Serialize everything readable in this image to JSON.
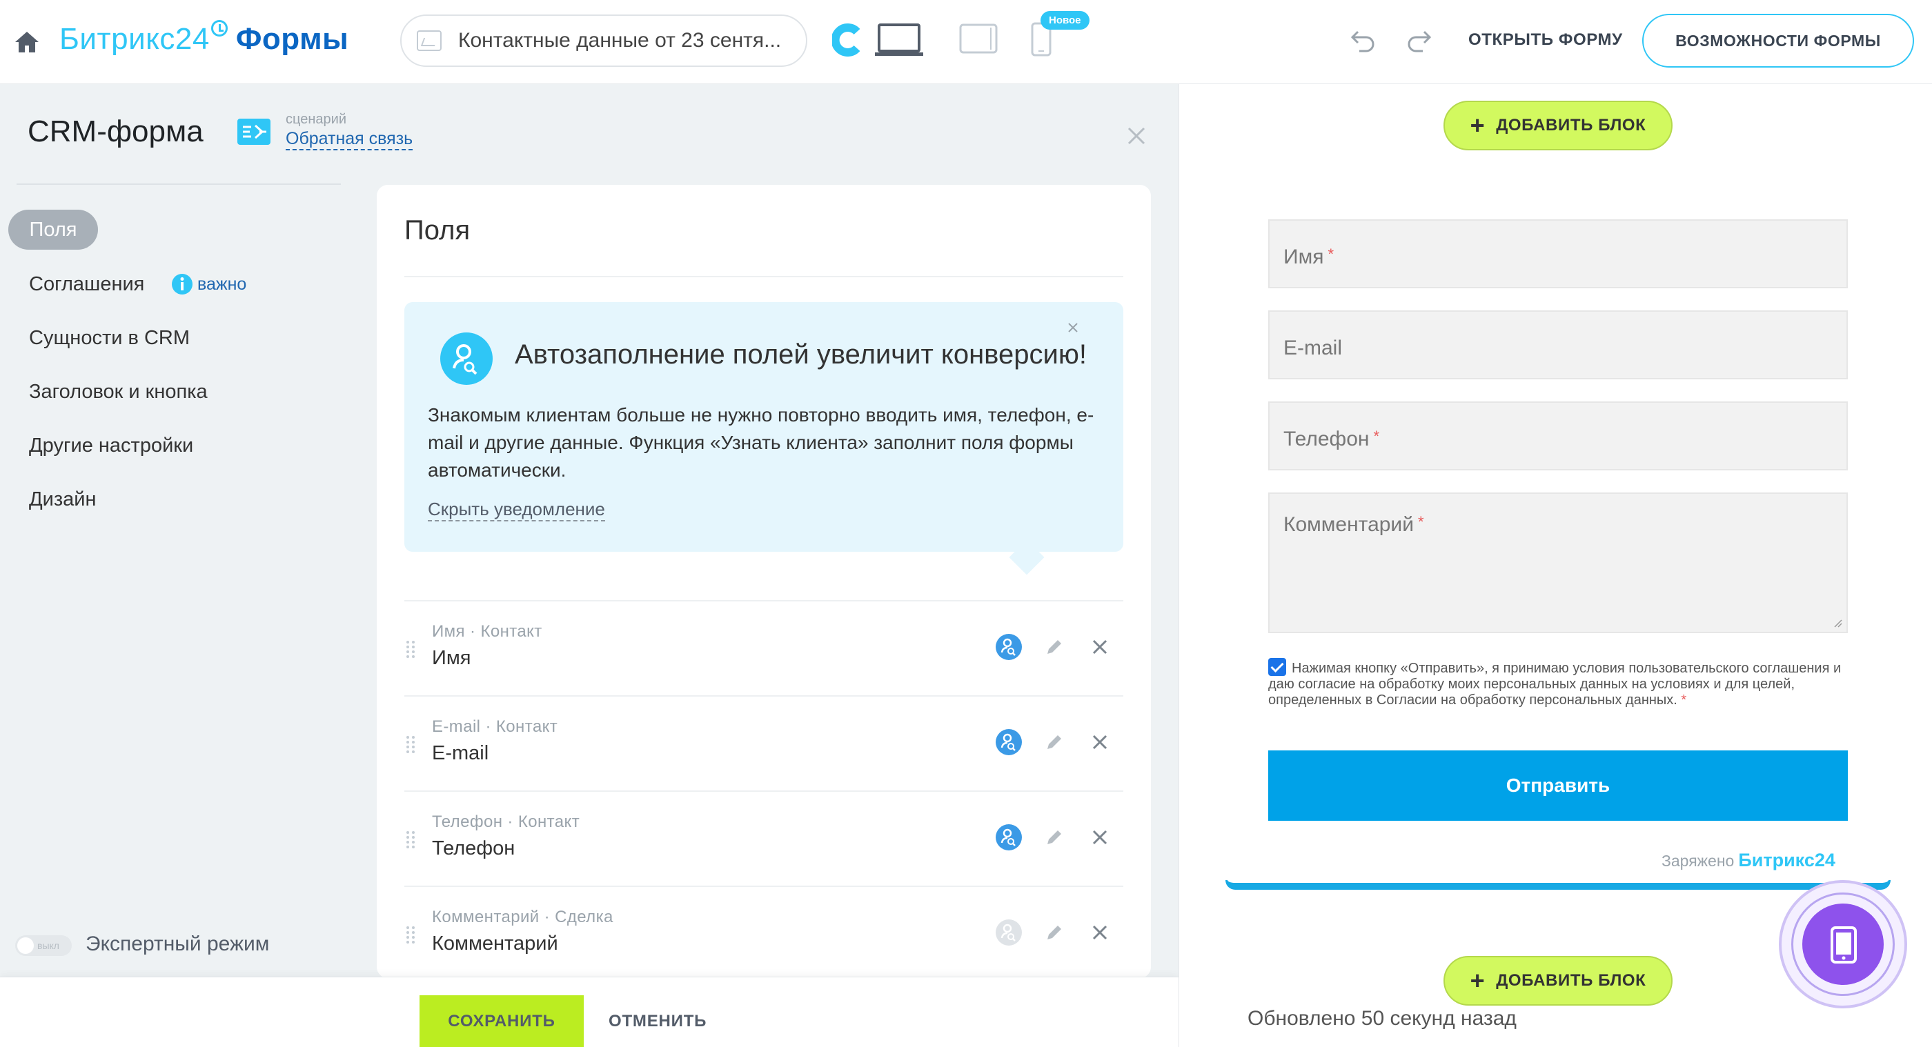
{
  "header": {
    "logo_b24": "Битрикс24",
    "logo_forms": "Формы",
    "form_title": "Контактные данные от 23 сентя...",
    "badge_new": "Новое",
    "open_form": "ОТКРЫТЬ ФОРМУ",
    "features": "ВОЗМОЖНОСТИ ФОРМЫ"
  },
  "sidebar": {
    "title": "CRM-форма",
    "scenario_label": "сценарий",
    "scenario_link": "Обратная связь",
    "items": [
      {
        "label": "Поля"
      },
      {
        "label": "Соглашения"
      },
      {
        "label": "Сущности в CRM"
      },
      {
        "label": "Заголовок и кнопка"
      },
      {
        "label": "Другие настройки"
      },
      {
        "label": "Дизайн"
      }
    ],
    "important": "важно",
    "expert_off": "выкл",
    "expert_label": "Экспертный режим"
  },
  "card": {
    "title": "Поля",
    "notice": {
      "title": "Автозаполнение полей увеличит конверсию!",
      "text": "Знакомым клиентам больше не нужно повторно вводить имя, телефон, e-mail и другие данные. Функция «Узнать клиента» заполнит поля формы автоматически.",
      "hide": "Скрыть уведомление"
    },
    "fields": [
      {
        "meta": "Имя · Контакт",
        "name": "Имя"
      },
      {
        "meta": "E-mail · Контакт",
        "name": "E-mail"
      },
      {
        "meta": "Телефон · Контакт",
        "name": "Телефон"
      },
      {
        "meta": "Комментарий · Сделка",
        "name": "Комментарий"
      }
    ]
  },
  "footer": {
    "save": "СОХРАНИТЬ",
    "cancel": "ОТМЕНИТЬ"
  },
  "preview": {
    "add_block": "ДОБАВИТЬ БЛОК",
    "inputs": [
      "Имя",
      "E-mail",
      "Телефон",
      "Комментарий"
    ],
    "required_mark": "*",
    "consent": "Нажимая кнопку «Отправить», я принимаю условия пользовательского соглашения и даю согласие на обработку моих персональных данных на условиях и для целей, определенных в Согласии на обработку персональных данных.",
    "submit": "Отправить",
    "powered": "Заряжено",
    "powered_brand": "Битрикс24",
    "updated": "Обновлено 50 секунд назад"
  },
  "colors": {
    "accent": "#2fc6f6",
    "brand_dark": "#0b66c3",
    "save_green": "#bbed21",
    "add_block_green": "#d2f95f",
    "submit_blue": "#00a2e8",
    "fab_purple": "#8e52ec"
  },
  "icons": [
    "home-icon",
    "device-c-icon",
    "laptop-icon",
    "tablet-icon",
    "phone-icon",
    "undo-icon",
    "redo-icon",
    "scenario-icon",
    "close-icon",
    "info-icon",
    "client-search-icon",
    "drag-handle-icon",
    "pencil-icon",
    "delete-icon",
    "plus-icon",
    "mobile-icon"
  ]
}
